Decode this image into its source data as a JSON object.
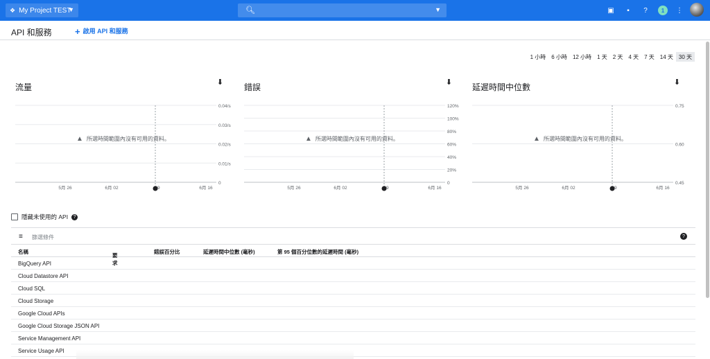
{
  "topbar": {
    "project_name": "My Project TEST",
    "notification_count": "1",
    "icons": [
      "project-icon",
      "search-icon",
      "dropdown-icon",
      "cloud-shell-icon",
      "feedback-icon",
      "help-icon",
      "more-vert-icon",
      "avatar"
    ],
    "color": "#1a73e8"
  },
  "page": {
    "title": "API 和服務",
    "enable_label": "啟用 API 和服務"
  },
  "time_ranges": {
    "options": [
      "1 小時",
      "6 小時",
      "12 小時",
      "1 天",
      "2 天",
      "4 天",
      "7 天",
      "14 天",
      "30 天"
    ],
    "selected": "30 天"
  },
  "charts": {
    "traffic": {
      "title": "流量",
      "yticks": [
        "0.04/s",
        "0.03/s",
        "0.02/s",
        "0.01/s",
        "0"
      ]
    },
    "errors": {
      "title": "錯誤",
      "yticks": [
        "120%",
        "100%",
        "80%",
        "60%",
        "40%",
        "20%",
        "0"
      ]
    },
    "latency": {
      "title": "延遲時間中位數",
      "yticks": [
        "0.75",
        "0.60",
        "0.45"
      ]
    },
    "xticks": [
      "5月 26",
      "6月 02",
      "09",
      "6月 16"
    ],
    "no_data": "所選時間範圍內沒有可用的資料。"
  },
  "chart_data": [
    {
      "type": "line",
      "title": "流量",
      "yticks": [
        "0.04/s",
        "0.03/s",
        "0.02/s",
        "0.01/s",
        "0"
      ],
      "ylim": [
        0,
        0.04
      ],
      "xticks": [
        "5月 26",
        "6月 02",
        "09",
        "6月 16"
      ],
      "series": []
    },
    {
      "type": "line",
      "title": "錯誤",
      "yticks": [
        "120%",
        "100%",
        "80%",
        "60%",
        "40%",
        "20%",
        "0"
      ],
      "ylim": [
        0,
        120
      ],
      "xticks": [
        "5月 26",
        "6月 02",
        "09",
        "6月 16"
      ],
      "series": []
    },
    {
      "type": "line",
      "title": "延遲時間中位數",
      "yticks": [
        "0.75",
        "0.60",
        "0.45"
      ],
      "ylim": [
        0.45,
        0.75
      ],
      "xticks": [
        "5月 26",
        "6月 02",
        "09",
        "6月 16"
      ],
      "series": []
    }
  ],
  "hide_unused": {
    "label": "隱藏未使用的 API"
  },
  "filter": {
    "placeholder": "篩選條件"
  },
  "table": {
    "columns": [
      "名稱",
      "要求",
      "錯誤百分比",
      "延遲時間中位數 (毫秒)",
      "第 95 個百分位數的延遲時間 (毫秒)"
    ],
    "rows": [
      "BigQuery API",
      "Cloud Datastore API",
      "Cloud SQL",
      "Cloud Storage",
      "Google Cloud APIs",
      "Google Cloud Storage JSON API",
      "Service Management API",
      "Service Usage API"
    ]
  }
}
